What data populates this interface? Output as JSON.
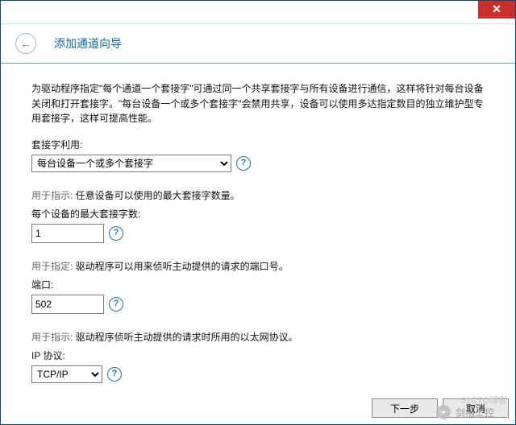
{
  "window": {
    "close_glyph": "✕",
    "back_glyph": "←",
    "title": "添加通道向导"
  },
  "intro": "为驱动程序指定\"每个通道一个套接字\"可通过同一个共享套接字与所有设备进行通信，这样将针对每台设备关闭和打开套接字。\"每台设备一个或多个套接字\"会禁用共享，设备可以使用多达指定数目的独立维护型专用套接字，这样可提高性能。",
  "fields": {
    "socket": {
      "label": "套接字利用:",
      "value": "每台设备一个或多个套接字"
    },
    "max_sockets": {
      "hint_prefix": "用于指示: ",
      "hint": "任意设备可以使用的最大套接字数量。",
      "label": "每个设备的最大套接字数:",
      "value": "1"
    },
    "port": {
      "hint_prefix": "用于指定: ",
      "hint": "驱动程序可以用来侦听主动提供的请求的端口号。",
      "label": "端口:",
      "value": "502"
    },
    "ip_protocol": {
      "hint_prefix": "用于指示: ",
      "hint": "驱动程序侦听主动提供的请求时所用的以太网协议。",
      "label": "IP 协议:",
      "value": "TCP/IP"
    }
  },
  "help_glyph": "?",
  "footer": {
    "next": "下一步",
    "cancel": "取消"
  },
  "watermark": {
    "icon": "✦",
    "text": "剑指工控"
  },
  "watermark2": "51CTO博客"
}
